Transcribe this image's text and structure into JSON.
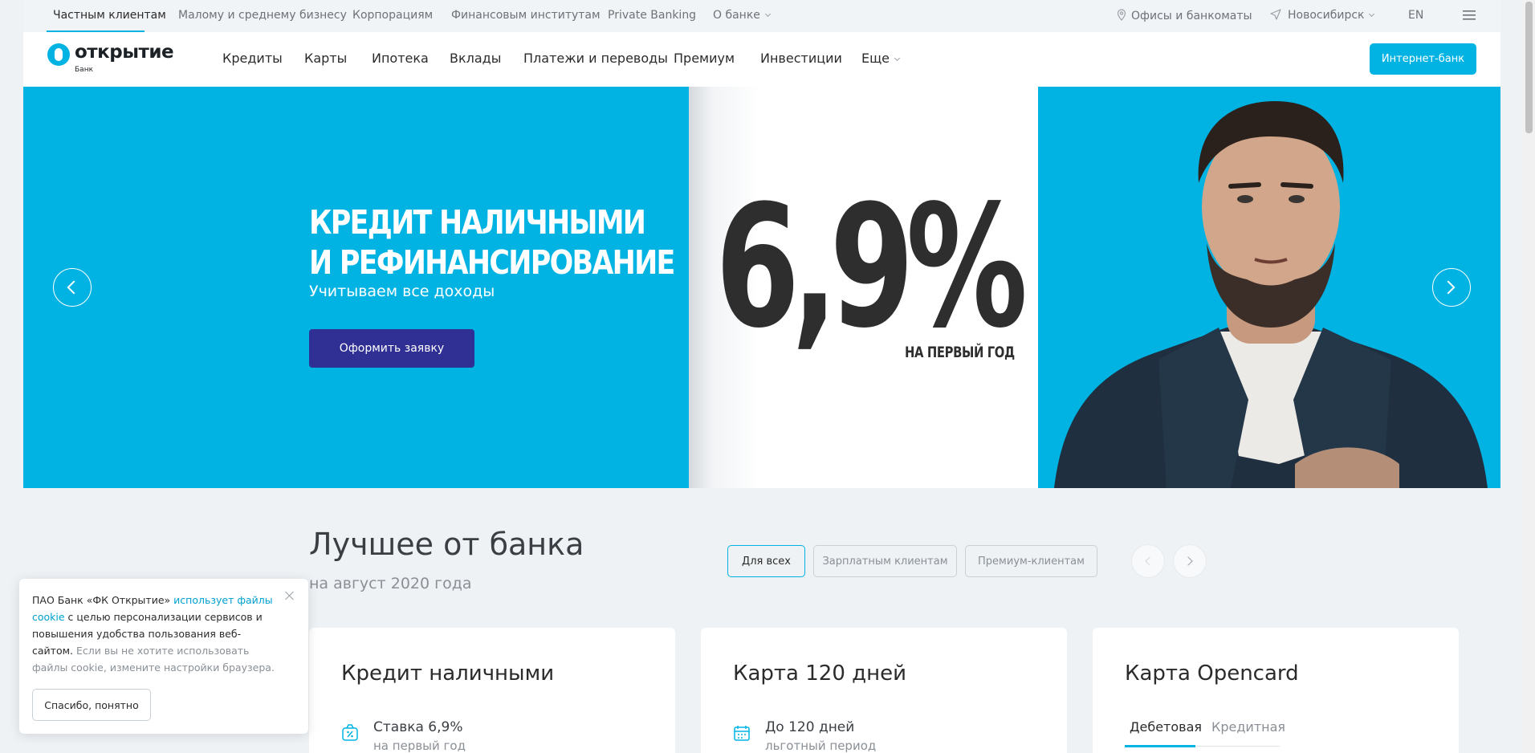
{
  "topbar": {
    "segments": [
      "Частным клиентам",
      "Малому и среднему бизнесу",
      "Корпорациям",
      "Финансовым институтам",
      "Private Banking",
      "О банке"
    ],
    "offices": "Офисы и банкоматы",
    "city": "Новосибирск",
    "lang": "EN"
  },
  "header": {
    "logo_text": "открытие",
    "logo_sub": "Банк",
    "nav": [
      "Кредиты",
      "Карты",
      "Ипотека",
      "Вклады",
      "Платежи и переводы",
      "Премиум",
      "Инвестиции",
      "Еще"
    ],
    "internet_bank": "Интернет-банк"
  },
  "hero": {
    "title_line1": "КРЕДИТ НАЛИЧНЫМИ",
    "title_line2": "И РЕФИНАНСИРОВАНИЕ",
    "subtitle": "Учитываем все доходы",
    "cta": "Оформить заявку",
    "rate": "6,9%",
    "rate_note": "НА ПЕРВЫЙ ГОД"
  },
  "best": {
    "title": "Лучшее от банка",
    "subtitle": "на август 2020 года",
    "filters": [
      "Для всех",
      "Зарплатным клиентам",
      "Премиум-клиентам"
    ]
  },
  "cards": [
    {
      "title": "Кредит наличными",
      "line1": "Ставка 6,9%",
      "line2": "на первый год"
    },
    {
      "title": "Карта 120 дней",
      "line1": "До 120 дней",
      "line2": "льготный период"
    },
    {
      "title": "Карта Opencard",
      "tabs": [
        "Дебетовая",
        "Кредитная"
      ]
    }
  ],
  "cookie": {
    "text_before": "ПАО Банк «ФК Открытие» ",
    "link": "использует файлы cookie",
    "text_after": " с целью персонализации сервисов и повышения удобства пользования веб-сайтом.",
    "note": "Если вы не хотите использовать файлы cookie, измените настройки браузера.",
    "button": "Спасибо, понятно"
  },
  "colors": {
    "accent": "#00b3e3",
    "cta": "#2f2f94",
    "text": "#2b2b2b"
  }
}
